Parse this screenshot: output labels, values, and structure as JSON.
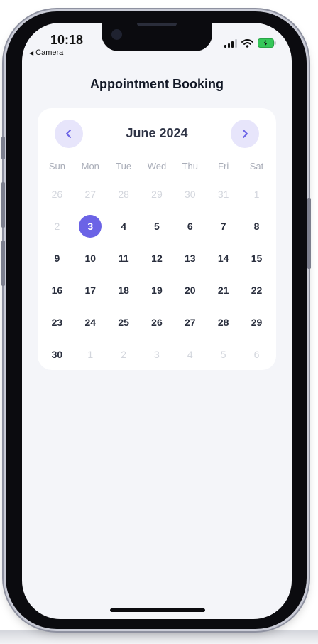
{
  "status_bar": {
    "time": "10:18",
    "back_app": "Camera",
    "icons": [
      "signal-icon",
      "wifi-icon",
      "battery-charging-icon"
    ]
  },
  "header": {
    "title": "Appointment Booking"
  },
  "calendar": {
    "month_label": "June 2024",
    "prev_icon": "chevron-left-icon",
    "next_icon": "chevron-right-icon",
    "weekdays": [
      "Sun",
      "Mon",
      "Tue",
      "Wed",
      "Thu",
      "Fri",
      "Sat"
    ],
    "selected_day": "3",
    "weeks": [
      [
        "26",
        "27",
        "28",
        "29",
        "30",
        "31",
        "1"
      ],
      [
        "2",
        "3",
        "4",
        "5",
        "6",
        "7",
        "8"
      ],
      [
        "9",
        "10",
        "11",
        "12",
        "13",
        "14",
        "15"
      ],
      [
        "16",
        "17",
        "18",
        "19",
        "20",
        "21",
        "22"
      ],
      [
        "23",
        "24",
        "25",
        "26",
        "27",
        "28",
        "29"
      ],
      [
        "30",
        "1",
        "2",
        "3",
        "4",
        "5",
        "6"
      ]
    ]
  },
  "colors": {
    "accent": "#6b63e6",
    "accent_soft": "#e7e5fb",
    "muted_day": "#d3d6dd",
    "background": "#f4f5f9"
  }
}
